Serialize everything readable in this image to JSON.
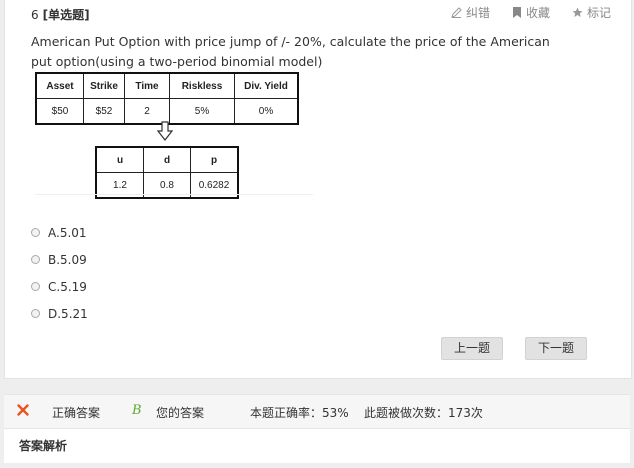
{
  "question": {
    "number": "6",
    "type": "[单选题]",
    "text": "American Put Option with price jump of /- 20%, calculate the price of the American put option(using a two-period binomial model)"
  },
  "tools": {
    "correct_error": "纠错",
    "favorite": "收藏",
    "mark": "标记"
  },
  "table1": {
    "headers": [
      "Asset",
      "Strike",
      "Time",
      "Riskless",
      "Div. Yield"
    ],
    "values": [
      "$50",
      "$52",
      "2",
      "5%",
      "0%"
    ]
  },
  "table2": {
    "headers": [
      "u",
      "d",
      "p"
    ],
    "values": [
      "1.2",
      "0.8",
      "0.6282"
    ]
  },
  "options": [
    {
      "label": "A.5.01"
    },
    {
      "label": "B.5.09"
    },
    {
      "label": "C.5.19"
    },
    {
      "label": "D.5.21"
    }
  ],
  "nav": {
    "prev": "上一题",
    "next": "下一题"
  },
  "answer_bar": {
    "correct_label": "正确答案",
    "user_answer": "B",
    "user_label": "您的答案",
    "rate": "本题正确率：53%",
    "count": "此题被做次数：173次"
  },
  "analysis": {
    "title": "答案解析"
  },
  "colors": {
    "wrong": "#e8541e",
    "user_answer": "#5fa82f"
  }
}
